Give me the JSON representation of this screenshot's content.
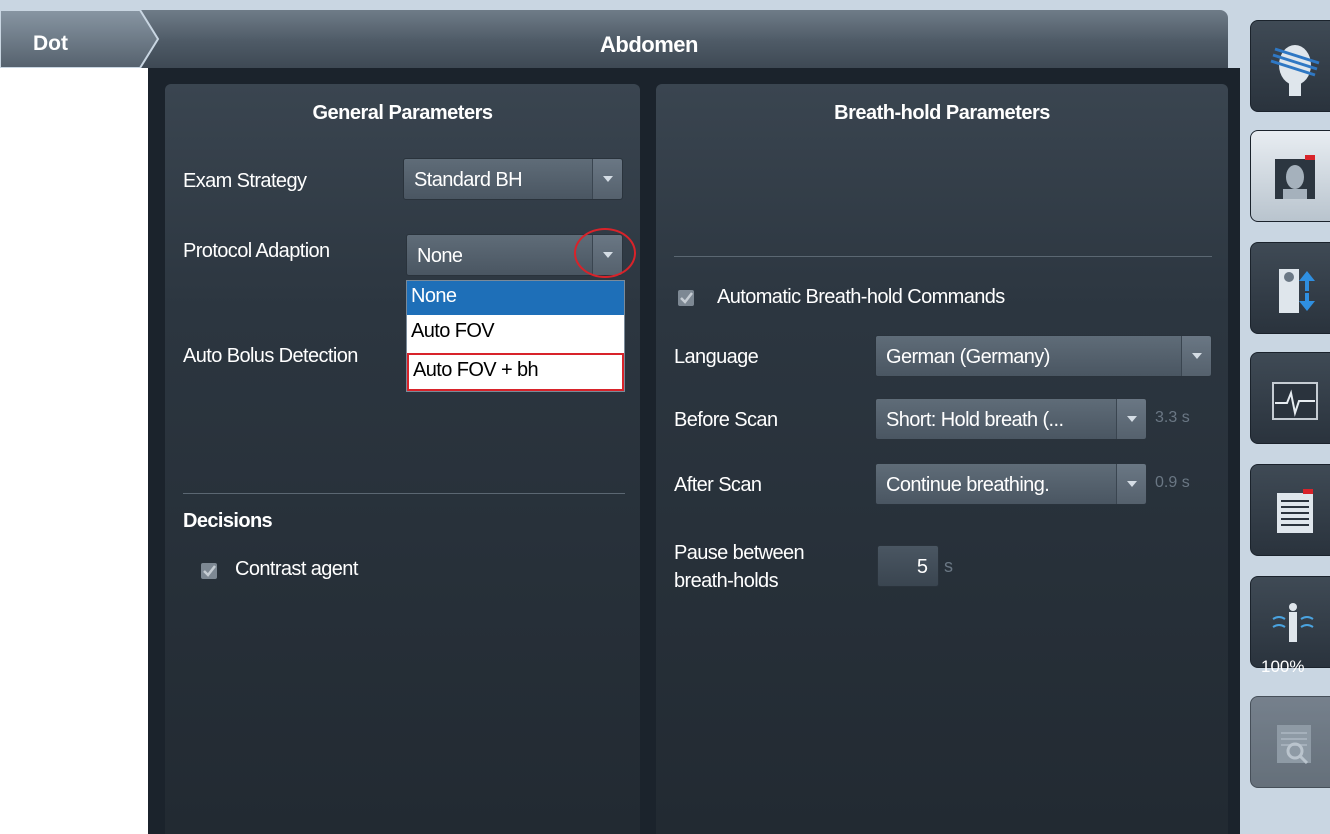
{
  "header": {
    "breadcrumb_tab": "Dot",
    "title": "Abdomen"
  },
  "general": {
    "title": "General Parameters",
    "exam_strategy": {
      "label": "Exam Strategy",
      "value": "Standard BH"
    },
    "protocol_adaption": {
      "label": "Protocol Adaption",
      "value": "None",
      "options": [
        "None",
        "Auto FOV",
        "Auto FOV + bh"
      ],
      "selected_index": 0,
      "highlighted_index": 2
    },
    "auto_bolus_label": "Auto Bolus Detection",
    "decisions_title": "Decisions",
    "contrast_agent_label": "Contrast agent",
    "contrast_agent_checked": true
  },
  "breath_hold": {
    "title": "Breath-hold Parameters",
    "auto_commands_label": "Automatic Breath-hold Commands",
    "auto_commands_checked": true,
    "language": {
      "label": "Language",
      "value": "German (Germany)"
    },
    "before_scan": {
      "label": "Before Scan",
      "value": "Short: Hold breath (...",
      "duration": "3.3 s"
    },
    "after_scan": {
      "label": "After Scan",
      "value": "Continue breathing.",
      "duration": "0.9 s"
    },
    "pause": {
      "label_line1": "Pause between",
      "label_line2": "breath-holds",
      "value": "5",
      "unit": "s"
    }
  },
  "toolbar": {
    "items": [
      "head-scan-icon",
      "patient-view-icon",
      "patient-position-icon",
      "physio-signal-icon",
      "protocol-list-icon",
      "body-coil-icon",
      "image-search-icon"
    ],
    "coil_percent": "100%"
  },
  "colors": {
    "accent": "#1e6fb8",
    "annotation_red": "#d8232a",
    "panel_bg": "#2c3640"
  }
}
